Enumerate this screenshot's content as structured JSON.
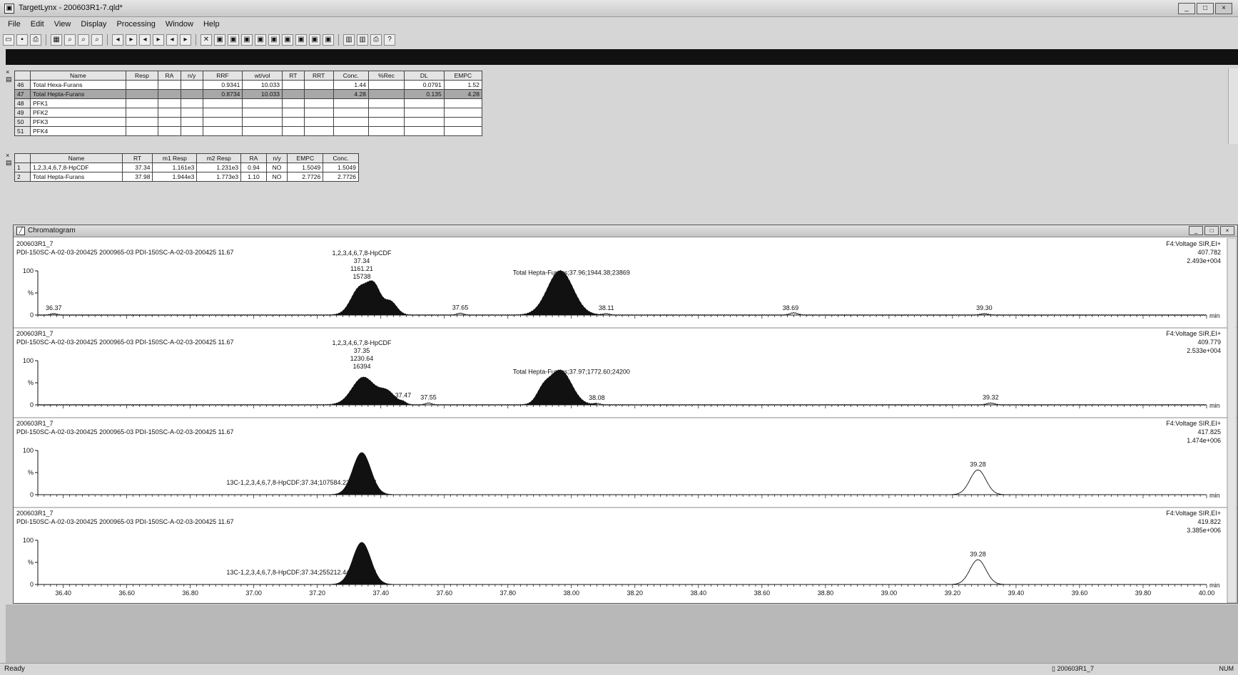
{
  "window": {
    "title": "TargetLynx - 200603R1-7.qld*",
    "buttons": [
      "_",
      "□",
      "×"
    ]
  },
  "menu": [
    "File",
    "Edit",
    "View",
    "Display",
    "Processing",
    "Window",
    "Help"
  ],
  "toolbar_icons": [
    "open-icon",
    "save-icon",
    "print-icon",
    "chart-icon",
    "zoom-icon",
    "zoom-icon",
    "zoom-icon",
    "nav-left-icon",
    "nav-right-icon",
    "nav-left-icon",
    "nav-right-icon",
    "nav-left-icon",
    "nav-right-icon",
    "close-icon",
    "graph-icon",
    "graph-icon",
    "graph-icon",
    "graph-icon",
    "graph-icon",
    "graph-icon",
    "graph-icon",
    "graph-icon",
    "graph-icon",
    "layout-icon",
    "layout-icon",
    "print-icon",
    "help-icon"
  ],
  "table1": {
    "columns": [
      "",
      "Name",
      "Resp",
      "RA",
      "n/y",
      "RRF",
      "wt/vol",
      "RT",
      "RRT",
      "Conc.",
      "%Rec",
      "DL",
      "EMPC"
    ],
    "rows": [
      {
        "id": "46",
        "name": "Total Hexa-Furans",
        "resp": "",
        "ra": "",
        "ny": "",
        "rrf": "0.9341",
        "wtvol": "10.033",
        "rt": "",
        "rrt": "",
        "conc": "1.44",
        "rec": "",
        "dl": "0.0791",
        "empc": "1.52",
        "selected": false
      },
      {
        "id": "47",
        "name": "Total Hepta-Furans",
        "resp": "",
        "ra": "",
        "ny": "",
        "rrf": "0.8734",
        "wtvol": "10.033",
        "rt": "",
        "rrt": "",
        "conc": "4.28",
        "rec": "",
        "dl": "0.135",
        "empc": "4.28",
        "selected": true
      },
      {
        "id": "48",
        "name": "PFK1",
        "resp": "",
        "ra": "",
        "ny": "",
        "rrf": "",
        "wtvol": "",
        "rt": "",
        "rrt": "",
        "conc": "",
        "rec": "",
        "dl": "",
        "empc": "",
        "selected": false
      },
      {
        "id": "49",
        "name": "PFK2",
        "resp": "",
        "ra": "",
        "ny": "",
        "rrf": "",
        "wtvol": "",
        "rt": "",
        "rrt": "",
        "conc": "",
        "rec": "",
        "dl": "",
        "empc": "",
        "selected": false
      },
      {
        "id": "50",
        "name": "PFK3",
        "resp": "",
        "ra": "",
        "ny": "",
        "rrf": "",
        "wtvol": "",
        "rt": "",
        "rrt": "",
        "conc": "",
        "rec": "",
        "dl": "",
        "empc": "",
        "selected": false
      },
      {
        "id": "51",
        "name": "PFK4",
        "resp": "",
        "ra": "",
        "ny": "",
        "rrf": "",
        "wtvol": "",
        "rt": "",
        "rrt": "",
        "conc": "",
        "rec": "",
        "dl": "",
        "empc": "",
        "selected": false
      }
    ]
  },
  "table2": {
    "columns": [
      "",
      "Name",
      "RT",
      "m1 Resp",
      "m2 Resp",
      "RA",
      "n/y",
      "EMPC",
      "Conc."
    ],
    "rows": [
      {
        "id": "1",
        "name": "1,2,3,4,6,7,8-HpCDF",
        "rt": "37.34",
        "m1": "1.161e3",
        "m2": "1.231e3",
        "ra": "0.94",
        "ny": "NO",
        "empc": "1.5049",
        "conc": "1.5049"
      },
      {
        "id": "2",
        "name": "Total Hepta-Furans",
        "rt": "37.98",
        "m1": "1.944e3",
        "m2": "1.773e3",
        "ra": "1.10",
        "ny": "NO",
        "empc": "2.7726",
        "conc": "2.7726"
      }
    ]
  },
  "chromatogram": {
    "window_title": "Chromatogram",
    "x_unit": "min",
    "x_ticks": [
      "36.40",
      "36.60",
      "36.80",
      "37.00",
      "37.20",
      "37.40",
      "37.60",
      "37.80",
      "38.00",
      "38.20",
      "38.40",
      "38.60",
      "38.80",
      "39.00",
      "39.20",
      "39.40",
      "39.60",
      "39.80",
      "40.00"
    ],
    "y_ticks": [
      "100",
      "%",
      "0"
    ],
    "traces": [
      {
        "sample": "200603R1_7",
        "desc": "PDI-150SC-A-02-03-200425 2000965-03 PDI-150SC-A-02-03-200425 11.67",
        "channel": "F4:Voltage SIR,EI+",
        "mass": "407.782",
        "intensity": "2.493e+004",
        "annotations": [
          {
            "lines": [
              "1,2,3,4,6,7,8-HpCDF",
              "37.34",
              "1161.21",
              "15738"
            ]
          },
          {
            "lines": [
              "Total Hepta-Furans;37.96;1944.38;23869"
            ]
          }
        ],
        "labels": [
          "36.37",
          "37.65",
          "38.11",
          "38.69",
          "39.30"
        ]
      },
      {
        "sample": "200603R1_7",
        "desc": "PDI-150SC-A-02-03-200425 2000965-03 PDI-150SC-A-02-03-200425 11.67",
        "channel": "F4:Voltage SIR,EI+",
        "mass": "409.779",
        "intensity": "2.533e+004",
        "annotations": [
          {
            "lines": [
              "1,2,3,4,6,7,8-HpCDF",
              "37.35",
              "1230.64",
              "16394"
            ]
          },
          {
            "lines": [
              "Total Hepta-Furans;37.97;1772.60;24200"
            ]
          }
        ],
        "labels": [
          "37.47",
          "37.55",
          "38.08",
          "39.32"
        ]
      },
      {
        "sample": "200603R1_7",
        "desc": "PDI-150SC-A-02-03-200425 2000965-03 PDI-150SC-A-02-03-200425 11.67",
        "channel": "F4:Voltage SIR,EI+",
        "mass": "417.825",
        "intensity": "1.474e+006",
        "annotations": [
          {
            "lines": [
              "13C-1,2,3,4,6,7,8-HpCDF;37.34;107584.23;1460267"
            ]
          }
        ],
        "labels": [
          "39.28"
        ]
      },
      {
        "sample": "200603R1_7",
        "desc": "PDI-150SC-A-02-03-200425 2000965-03 PDI-150SC-A-02-03-200425 11.67",
        "channel": "F4:Voltage SIR,EI+",
        "mass": "419.822",
        "intensity": "3.385e+006",
        "annotations": [
          {
            "lines": [
              "13C-1,2,3,4,6,7,8-HpCDF;37.34;255212.44;3363846"
            ]
          }
        ],
        "labels": [
          "39.28"
        ]
      }
    ]
  },
  "status": {
    "ready": "Ready",
    "file": "200603R1_7",
    "num": "NUM"
  }
}
